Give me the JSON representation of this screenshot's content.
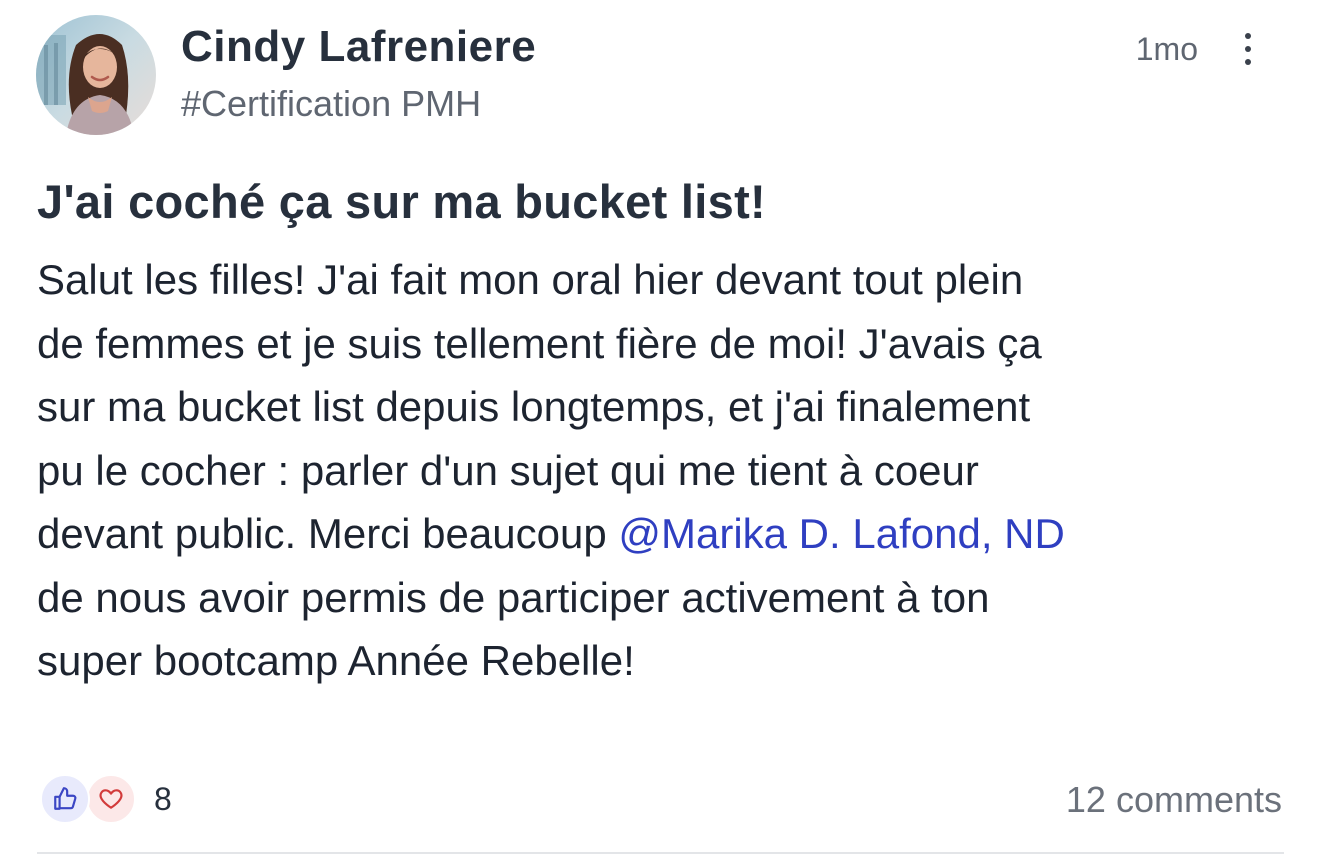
{
  "post": {
    "author_name": "Cindy Lafreniere",
    "space_tag": "#Certification PMH",
    "timestamp": "1mo",
    "title": "J'ai coché ça sur ma bucket list!",
    "body_lines": [
      "Salut les filles! J'ai fait mon oral hier devant tout plein",
      "de femmes et je suis tellement fière de moi! J'avais ça",
      "sur ma bucket list depuis longtemps, et j'ai finalement",
      "pu le cocher : parler d'un sujet qui me tient à coeur"
    ],
    "body_line5_before_mention": "devant public. Merci beaucoup ",
    "mention": "@Marika D. Lafond, ND",
    "body_lines_after": [
      "de nous avoir permis de participer activement à ton",
      "super bootcamp Année Rebelle!"
    ],
    "reactions": {
      "icons": [
        "thumbs-up-icon",
        "heart-icon"
      ],
      "count": "8"
    },
    "comments_label": "12 comments"
  },
  "colors": {
    "text_primary": "#27303d",
    "text_secondary": "#5f6671",
    "mention": "#2f3fc1",
    "like_bg": "#e8eafc",
    "like_stroke": "#3b46c4",
    "love_bg": "#fce8e8",
    "love_stroke": "#d23b3b"
  }
}
